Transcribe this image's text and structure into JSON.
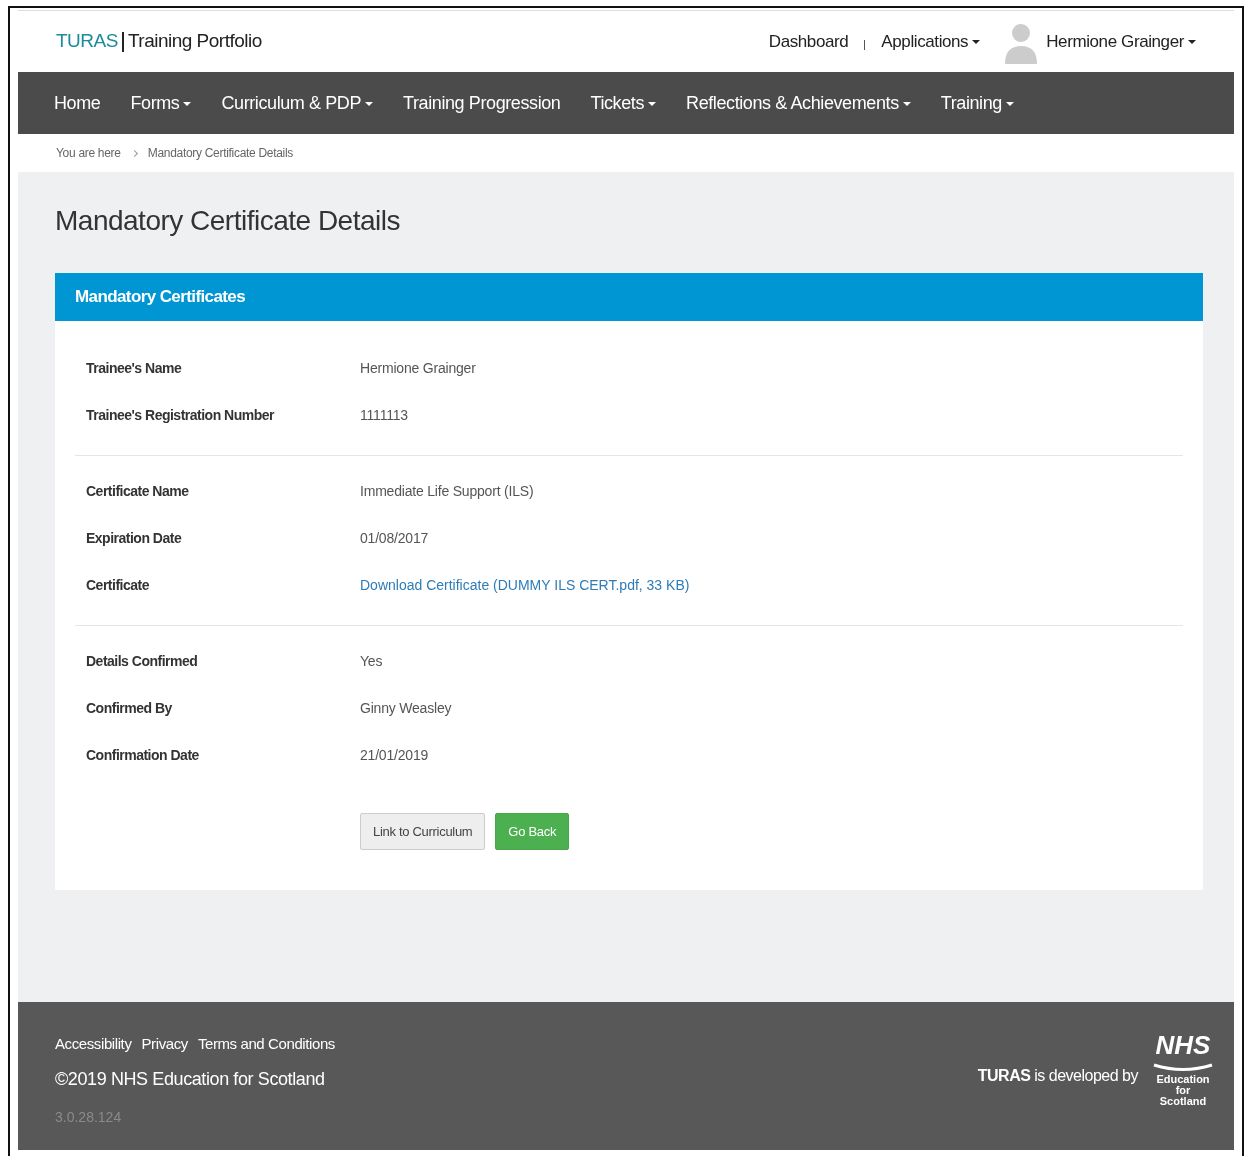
{
  "brand": {
    "name": "TURAS",
    "product": "Training Portfolio"
  },
  "top_links": [
    {
      "label": "Dashboard",
      "dropdown": false
    },
    {
      "label": "Applications",
      "dropdown": true
    }
  ],
  "user": {
    "name": "Hermione Grainger",
    "dropdown": true
  },
  "nav": [
    {
      "label": "Home",
      "dropdown": false
    },
    {
      "label": "Forms",
      "dropdown": true
    },
    {
      "label": "Curriculum & PDP",
      "dropdown": true
    },
    {
      "label": "Training Progression",
      "dropdown": false
    },
    {
      "label": "Tickets",
      "dropdown": true
    },
    {
      "label": "Reflections & Achievements",
      "dropdown": true
    },
    {
      "label": "Training",
      "dropdown": true
    }
  ],
  "breadcrumb": [
    "You are here",
    "Mandatory Certificate Details"
  ],
  "page_title": "Mandatory Certificate Details",
  "panel": {
    "title": "Mandatory Certificates",
    "groups": [
      [
        {
          "label": "Trainee's Name",
          "value": "Hermione Grainger",
          "kind": "text"
        },
        {
          "label": "Trainee's Registration Number",
          "value": "1111113",
          "kind": "text"
        }
      ],
      [
        {
          "label": "Certificate Name",
          "value": "Immediate Life Support (ILS)",
          "kind": "text"
        },
        {
          "label": "Expiration Date",
          "value": "01/08/2017",
          "kind": "text"
        },
        {
          "label": "Certificate",
          "value": "Download Certificate (DUMMY ILS CERT.pdf, 33 KB)",
          "kind": "link"
        }
      ],
      [
        {
          "label": "Details Confirmed",
          "value": "Yes",
          "kind": "text"
        },
        {
          "label": "Confirmed By",
          "value": "Ginny Weasley",
          "kind": "text"
        },
        {
          "label": "Confirmation Date",
          "value": "21/01/2019",
          "kind": "text"
        }
      ]
    ],
    "buttons": [
      {
        "label": "Link to Curriculum",
        "kind": "default"
      },
      {
        "label": "Go Back",
        "kind": "success"
      }
    ]
  },
  "footer": {
    "links": [
      "Accessibility",
      "Privacy",
      "Terms and Conditions"
    ],
    "copyright": "©2019 NHS Education for Scotland",
    "version": "3.0.28.124",
    "credit_brand": "TURAS",
    "credit_text": "is developed by",
    "logo_lines": [
      "NHS",
      "Education",
      "for",
      "Scotland"
    ]
  }
}
